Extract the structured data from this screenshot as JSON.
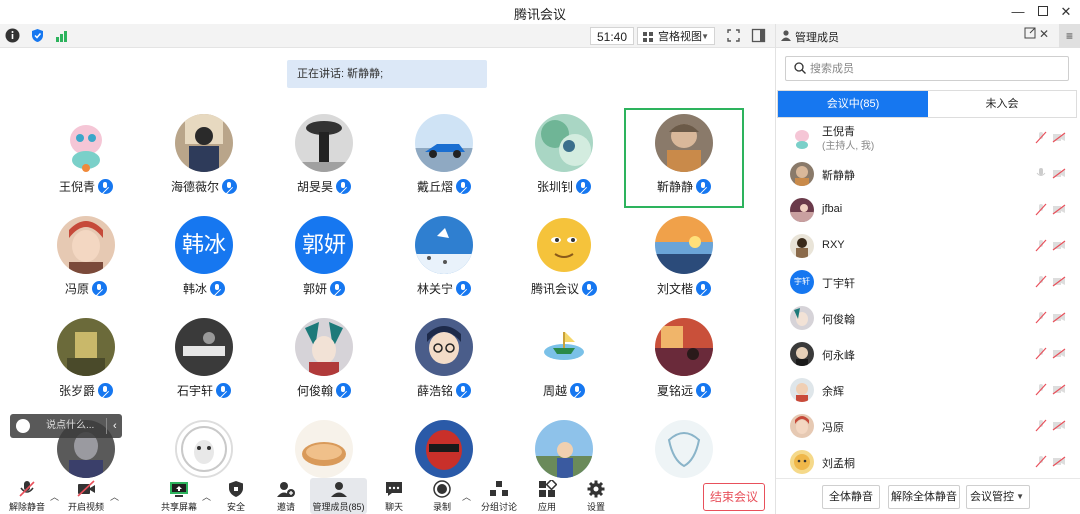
{
  "window": {
    "title": "腾讯会议"
  },
  "statusbar": {
    "timer": "51:40",
    "view_label": "宫格视图"
  },
  "speaking": {
    "text": "正在讲话: 靳静静;"
  },
  "grid": {
    "rows": [
      [
        "王倪青",
        "海德薇尔",
        "胡旻昊",
        "戴丘熠",
        "张圳钊",
        "靳静静"
      ],
      [
        "冯原",
        "韩冰",
        "郭妍",
        "林关宁",
        "腾讯会议",
        "刘文楷"
      ],
      [
        "张岁爵",
        "石宇轩",
        "何俊翰",
        "薛浩铭",
        "周越",
        "夏铭远"
      ]
    ],
    "text_avatars": {
      "han": "韩冰",
      "guo": "郭妍"
    }
  },
  "chat": {
    "placeholder": "说点什么..."
  },
  "toolbar": {
    "unmute": "解除静音",
    "video": "开启视频",
    "share": "共享屏幕",
    "security": "安全",
    "invite": "邀请",
    "members": "管理成员(85)",
    "chat": "聊天",
    "record": "录制",
    "breakout": "分组讨论",
    "apps": "应用",
    "settings": "设置",
    "end": "结束会议"
  },
  "sidebar": {
    "title": "管理成员",
    "search_placeholder": "搜索成员",
    "tab_in": "会议中(85)",
    "tab_out": "未入会",
    "members": [
      {
        "name": "王倪青",
        "sub": "(主持人, 我)"
      },
      {
        "name": "靳静静"
      },
      {
        "name": "jfbai"
      },
      {
        "name": "RXY"
      },
      {
        "name": "丁宇轩",
        "avatar_text": "宇轩"
      },
      {
        "name": "何俊翰"
      },
      {
        "name": "何永峰"
      },
      {
        "name": "余辉"
      },
      {
        "name": "冯原"
      },
      {
        "name": "刘孟桐"
      }
    ],
    "footer": {
      "mute_all": "全体静音",
      "unmute_all": "解除全体静音",
      "control": "会议管控"
    }
  },
  "colors": {
    "accent": "#1677f0",
    "active_border": "#2db35d",
    "end_red": "#e8505b"
  }
}
